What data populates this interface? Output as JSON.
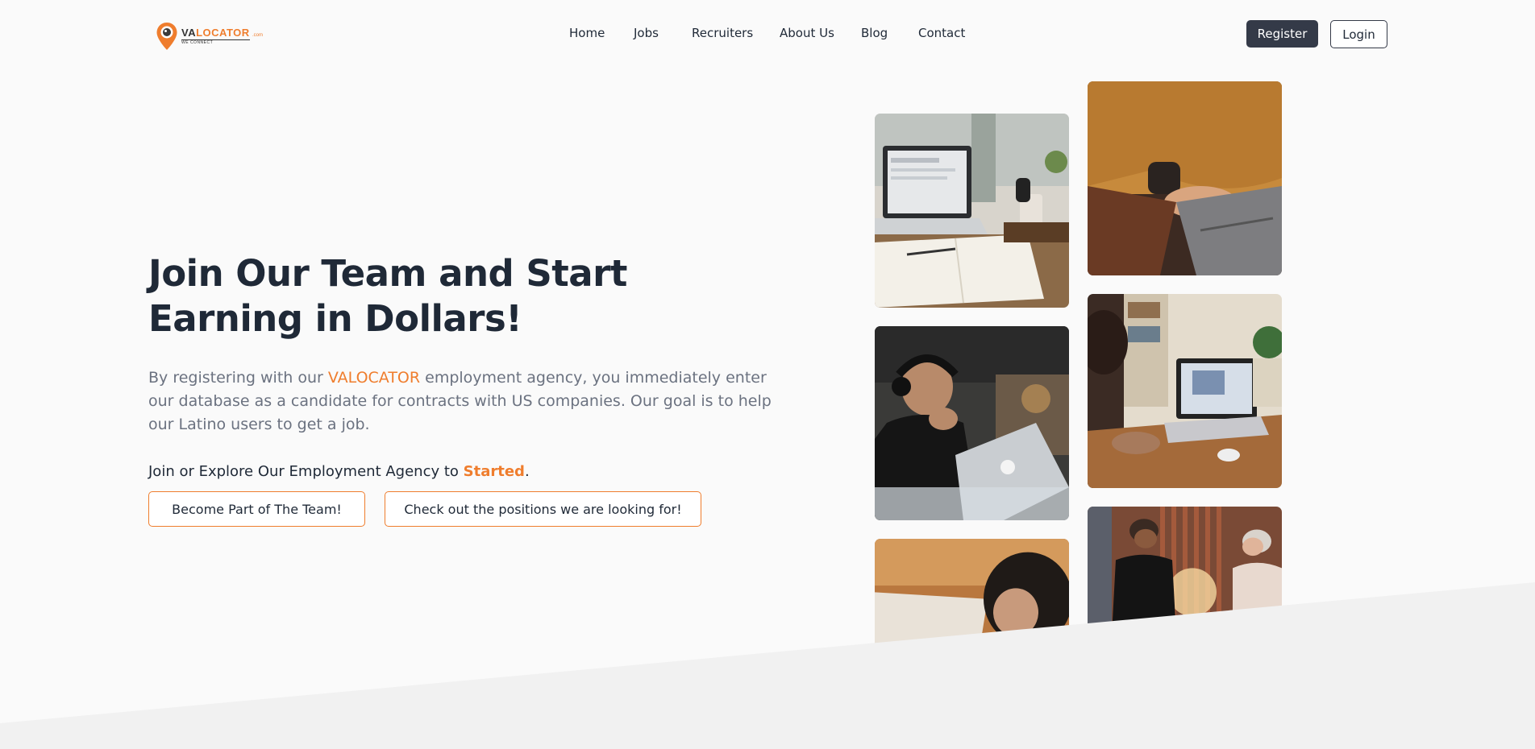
{
  "logo": {
    "main_prefix": "VA",
    "main_suffix": "LOCATOR",
    "dotcom": ".com",
    "tagline": "WE CONNECT"
  },
  "nav": {
    "items": [
      {
        "label": "Home"
      },
      {
        "label": "Jobs"
      },
      {
        "label": "Recruiters"
      },
      {
        "label": "About Us"
      },
      {
        "label": "Blog"
      },
      {
        "label": "Contact"
      }
    ],
    "register_label": "Register",
    "login_label": "Login"
  },
  "hero": {
    "title": "Join Our Team and Start Earning in Dollars!",
    "desc_before": "By registering with our ",
    "desc_brand": "VALOCATOR",
    "desc_after": " employment agency, you immediately enter our database as a candidate for contracts with US companies. Our goal is to help our Latino users to get a job.",
    "join_before": "Join or Explore Our Employment Agency to ",
    "join_accent": "Started",
    "join_after": ".",
    "button_team": "Become Part of The Team!",
    "button_positions": "Check out the positions we are looking for!"
  },
  "colors": {
    "accent": "#ef7d2d",
    "dark": "#343a48",
    "text": "#1f2937",
    "muted": "#6b7280",
    "background": "#fafafa",
    "wedge": "#f1f1f1"
  }
}
